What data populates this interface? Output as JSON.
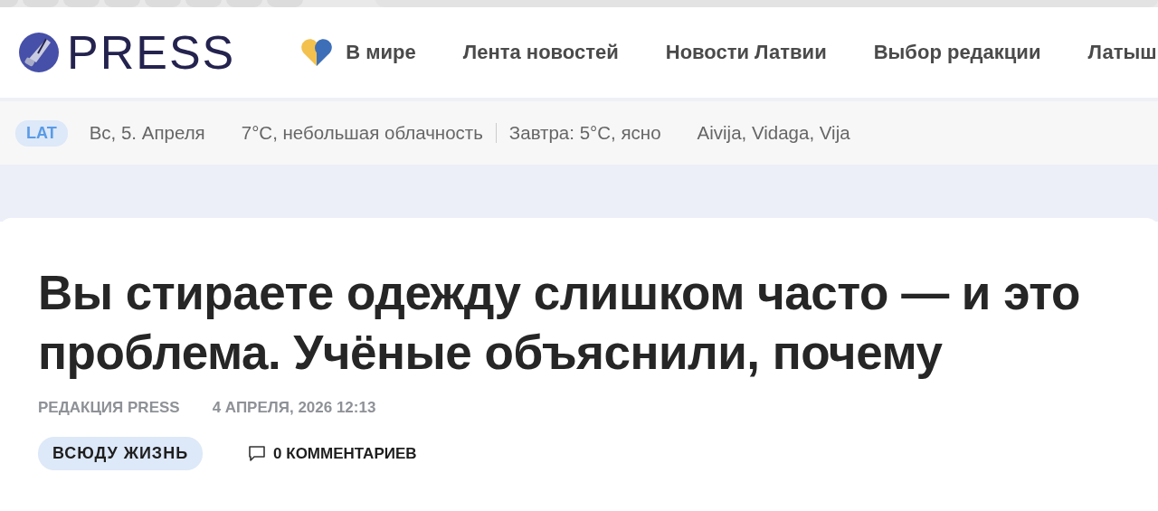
{
  "header": {
    "logo": "PRESS",
    "nav": [
      {
        "label": "В мире",
        "kind": "heart"
      },
      {
        "label": "Лента новостей",
        "kind": "plain"
      },
      {
        "label": "Новости Латвии",
        "kind": "plain"
      },
      {
        "label": "Выбор редакции",
        "kind": "plain"
      },
      {
        "label": "Латыш",
        "kind": "plain"
      }
    ]
  },
  "infobar": {
    "lang": "LAT",
    "date": "Вс, 5. Апреля",
    "weather": "7°C, небольшая облачность",
    "tomorrow": "Завтра: 5°C, ясно",
    "namedays": "Aivija, Vidaga, Vija"
  },
  "article": {
    "title": "Вы стираете одежду слишком часто — и это проблема. Учёные объяснили, почему",
    "author": "РЕДАКЦИЯ PRESS",
    "date": "4 АПРЕЛЯ, 2026 12:13",
    "tag": "ВСЮДУ ЖИЗНЬ",
    "comments": "0 КОММЕНТАРИЕВ"
  }
}
